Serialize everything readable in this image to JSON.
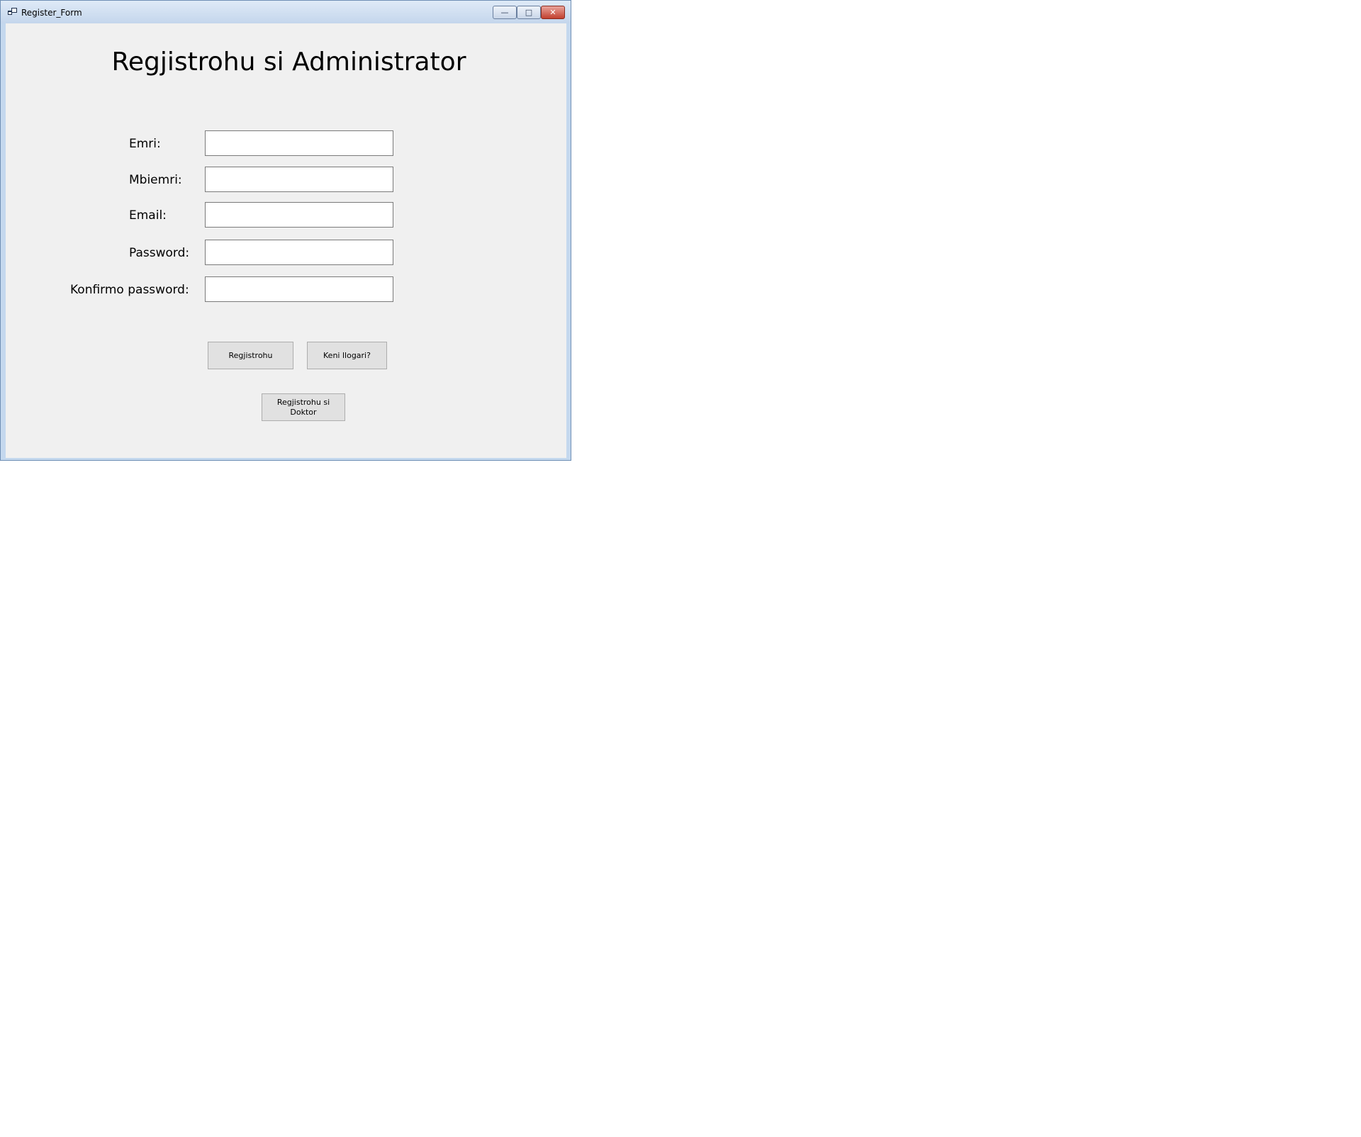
{
  "window": {
    "title": "Register_Form",
    "controls": {
      "minimize": "—",
      "maximize": "□",
      "close": "✕"
    }
  },
  "form": {
    "heading": "Regjistrohu si Administrator",
    "fields": [
      {
        "label": "Emri:",
        "value": ""
      },
      {
        "label": "Mbiemri:",
        "value": ""
      },
      {
        "label": "Email:",
        "value": ""
      },
      {
        "label": "Password:",
        "value": ""
      },
      {
        "label": "Konfirmo password:",
        "value": ""
      }
    ],
    "buttons": {
      "register": "Regjistrohu",
      "have_account": "Keni llogari?",
      "register_doctor": "Regjistrohu si Doktor"
    }
  }
}
